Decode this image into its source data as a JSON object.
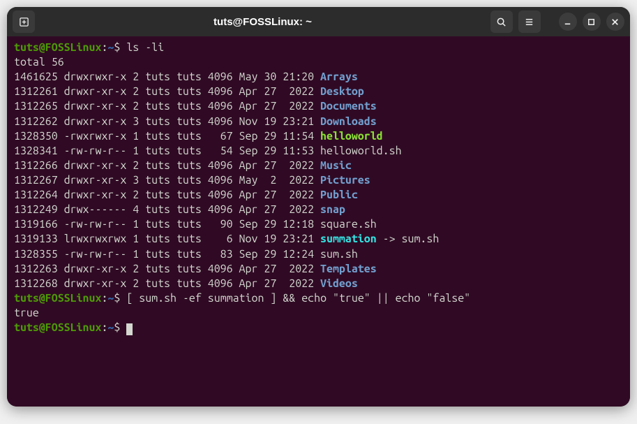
{
  "window": {
    "title": "tuts@FOSSLinux: ~"
  },
  "prompt": {
    "user_host": "tuts@FOSSLinux",
    "colon": ":",
    "path": "~",
    "symbol": "$"
  },
  "commands": {
    "cmd1": "ls -li",
    "cmd2": "[ sum.sh -ef summation ] && echo \"true\" || echo \"false\""
  },
  "output": {
    "total_line": "total 56",
    "result": "true"
  },
  "listing": [
    {
      "inode": "1461625",
      "perm": "drwxrwxr-x",
      "links": "2",
      "owner": "tuts",
      "group": "tuts",
      "size": "4096",
      "month": "May",
      "day": "30",
      "time": "21:20",
      "name": "Arrays",
      "type": "dir",
      "target": ""
    },
    {
      "inode": "1312261",
      "perm": "drwxr-xr-x",
      "links": "2",
      "owner": "tuts",
      "group": "tuts",
      "size": "4096",
      "month": "Apr",
      "day": "27",
      "time": " 2022",
      "name": "Desktop",
      "type": "dir",
      "target": ""
    },
    {
      "inode": "1312265",
      "perm": "drwxr-xr-x",
      "links": "2",
      "owner": "tuts",
      "group": "tuts",
      "size": "4096",
      "month": "Apr",
      "day": "27",
      "time": " 2022",
      "name": "Documents",
      "type": "dir",
      "target": ""
    },
    {
      "inode": "1312262",
      "perm": "drwxr-xr-x",
      "links": "3",
      "owner": "tuts",
      "group": "tuts",
      "size": "4096",
      "month": "Nov",
      "day": "19",
      "time": "23:21",
      "name": "Downloads",
      "type": "dir",
      "target": ""
    },
    {
      "inode": "1328350",
      "perm": "-rwxrwxr-x",
      "links": "1",
      "owner": "tuts",
      "group": "tuts",
      "size": "  67",
      "month": "Sep",
      "day": "29",
      "time": "11:54",
      "name": "helloworld",
      "type": "exec",
      "target": ""
    },
    {
      "inode": "1328341",
      "perm": "-rw-rw-r--",
      "links": "1",
      "owner": "tuts",
      "group": "tuts",
      "size": "  54",
      "month": "Sep",
      "day": "29",
      "time": "11:53",
      "name": "helloworld.sh",
      "type": "plain",
      "target": ""
    },
    {
      "inode": "1312266",
      "perm": "drwxr-xr-x",
      "links": "2",
      "owner": "tuts",
      "group": "tuts",
      "size": "4096",
      "month": "Apr",
      "day": "27",
      "time": " 2022",
      "name": "Music",
      "type": "dir",
      "target": ""
    },
    {
      "inode": "1312267",
      "perm": "drwxr-xr-x",
      "links": "3",
      "owner": "tuts",
      "group": "tuts",
      "size": "4096",
      "month": "May",
      "day": " 2",
      "time": " 2022",
      "name": "Pictures",
      "type": "dir",
      "target": ""
    },
    {
      "inode": "1312264",
      "perm": "drwxr-xr-x",
      "links": "2",
      "owner": "tuts",
      "group": "tuts",
      "size": "4096",
      "month": "Apr",
      "day": "27",
      "time": " 2022",
      "name": "Public",
      "type": "dir",
      "target": ""
    },
    {
      "inode": "1312249",
      "perm": "drwx------",
      "links": "4",
      "owner": "tuts",
      "group": "tuts",
      "size": "4096",
      "month": "Apr",
      "day": "27",
      "time": " 2022",
      "name": "snap",
      "type": "dir",
      "target": ""
    },
    {
      "inode": "1319166",
      "perm": "-rw-rw-r--",
      "links": "1",
      "owner": "tuts",
      "group": "tuts",
      "size": "  90",
      "month": "Sep",
      "day": "29",
      "time": "12:18",
      "name": "square.sh",
      "type": "plain",
      "target": ""
    },
    {
      "inode": "1319133",
      "perm": "lrwxrwxrwx",
      "links": "1",
      "owner": "tuts",
      "group": "tuts",
      "size": "   6",
      "month": "Nov",
      "day": "19",
      "time": "23:21",
      "name": "summation",
      "type": "link",
      "target": " -> sum.sh"
    },
    {
      "inode": "1328355",
      "perm": "-rw-rw-r--",
      "links": "1",
      "owner": "tuts",
      "group": "tuts",
      "size": "  83",
      "month": "Sep",
      "day": "29",
      "time": "12:24",
      "name": "sum.sh",
      "type": "plain",
      "target": ""
    },
    {
      "inode": "1312263",
      "perm": "drwxr-xr-x",
      "links": "2",
      "owner": "tuts",
      "group": "tuts",
      "size": "4096",
      "month": "Apr",
      "day": "27",
      "time": " 2022",
      "name": "Templates",
      "type": "dir",
      "target": ""
    },
    {
      "inode": "1312268",
      "perm": "drwxr-xr-x",
      "links": "2",
      "owner": "tuts",
      "group": "tuts",
      "size": "4096",
      "month": "Apr",
      "day": "27",
      "time": " 2022",
      "name": "Videos",
      "type": "dir",
      "target": ""
    }
  ]
}
